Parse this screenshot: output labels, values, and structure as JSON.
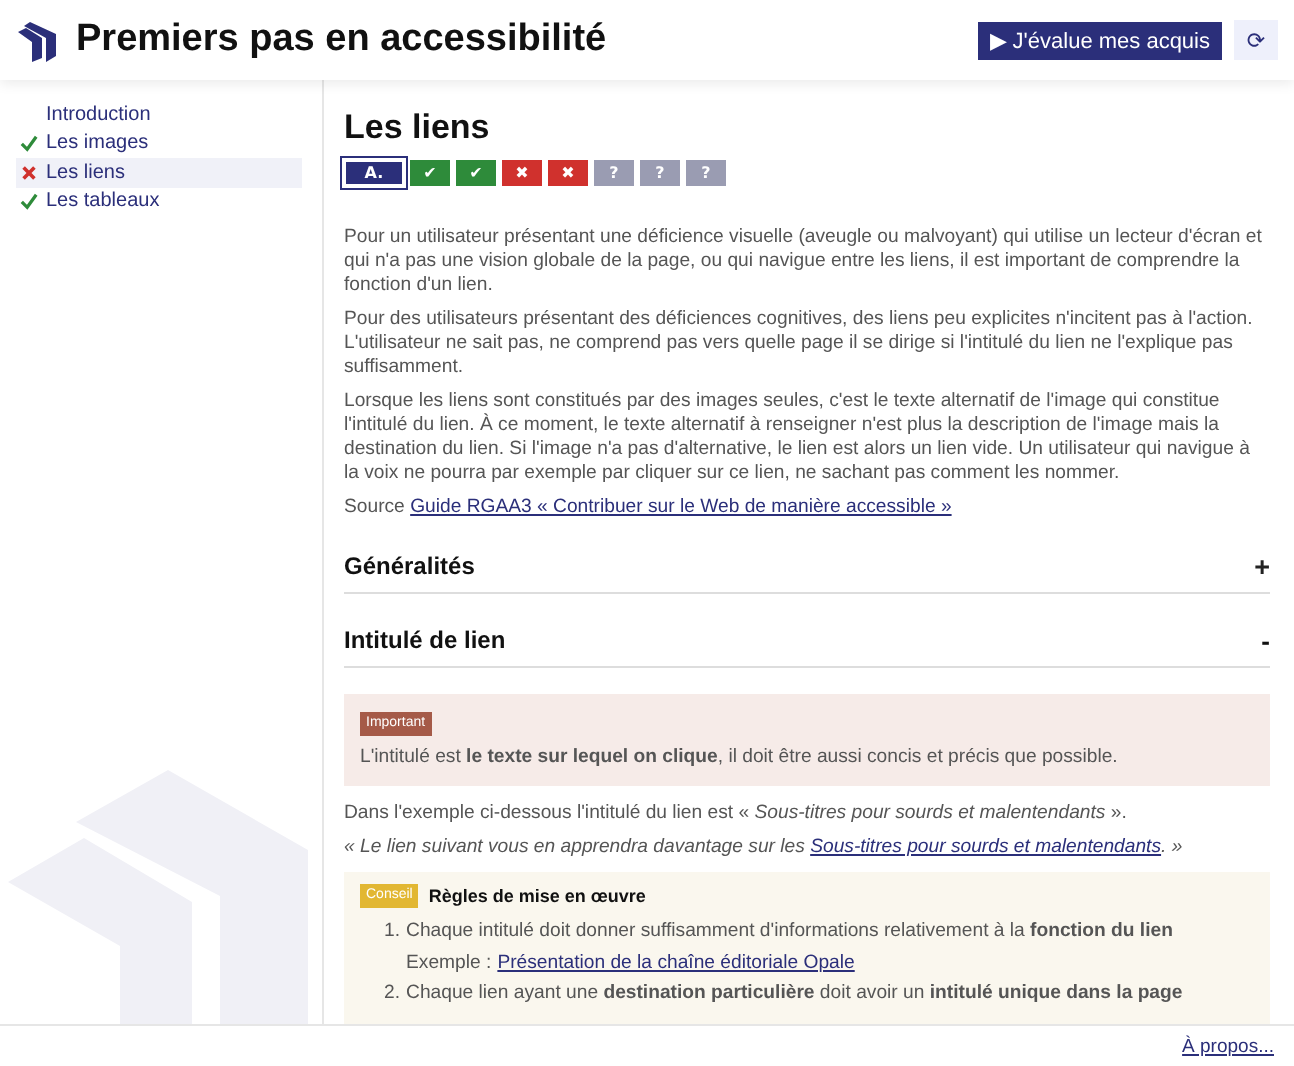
{
  "header": {
    "title": "Premiers pas en accessibilité",
    "evaluate_button": "▶ J'évalue mes acquis",
    "reset_button": "⟳"
  },
  "sidebar": {
    "items": [
      {
        "label": "Introduction",
        "kind": "plain",
        "selected": false
      },
      {
        "label": "Les images",
        "kind": "done",
        "selected": false
      },
      {
        "label": "Les liens",
        "kind": "failed",
        "selected": true
      },
      {
        "label": "Les tableaux",
        "kind": "done",
        "selected": false
      }
    ]
  },
  "content": {
    "title": "Les liens",
    "steps": [
      {
        "label": "A.",
        "kind": "current",
        "selected": true
      },
      {
        "label": "✔",
        "kind": "pass",
        "selected": false
      },
      {
        "label": "✔",
        "kind": "pass",
        "selected": false
      },
      {
        "label": "✖",
        "kind": "fail",
        "selected": false
      },
      {
        "label": "✖",
        "kind": "fail",
        "selected": false
      },
      {
        "label": "?",
        "kind": "unknown",
        "selected": false
      },
      {
        "label": "?",
        "kind": "unknown",
        "selected": false
      },
      {
        "label": "?",
        "kind": "unknown",
        "selected": false
      }
    ],
    "paragraphs": [
      "Pour un utilisateur présentant une déficience visuelle (aveugle ou malvoyant) qui utilise un lecteur d'écran et qui n'a pas une vision globale de la page, ou qui navigue entre les liens, il est important de comprendre la fonction d'un lien.",
      "Pour des utilisateurs présentant des déficiences cognitives, des liens peu explicites n'incitent pas à l'action. L'utilisateur ne sait pas, ne comprend pas vers quelle page il se dirige si l'intitulé du lien ne l'explique pas suffisamment.",
      "Lorsque les liens sont constitués par des images seules, c'est le texte alternatif de l'image qui constitue l'intitulé du lien. À ce moment, le texte alternatif à renseigner n'est plus la description de l'image mais la destination du lien. Si l'image n'a pas d'alternative, le lien est alors un lien vide. Un utilisateur qui navigue à la voix ne pourra par exemple par cliquer sur ce lien, ne sachant pas comment les nommer."
    ],
    "source": {
      "label": "Source",
      "link": "Guide RGAA3 « Contribuer sur le Web de manière accessible »"
    },
    "sections": [
      {
        "title": "Généralités",
        "toggle": "+",
        "expanded": false
      },
      {
        "title": "Intitulé de lien",
        "toggle": "-",
        "expanded": true,
        "important": {
          "badge": "Important",
          "text": "L'intitulé est **le texte sur lequel on clique**, il doit être aussi concis et précis que possible."
        },
        "example": "Dans l'exemple ci-dessous l'intitulé du lien est « *Sous-titres pour sourds et malentendants* ».",
        "quote": {
          "before": "« Le lien suivant vous en apprendra davantage sur les",
          "link": "Sous-titres pour sourds et malentendants",
          "after": ". »"
        },
        "advice": {
          "badge": "Conseil",
          "title": "Règles de mise en œuvre",
          "rules": [
            {
              "number": "1.",
              "text": "Chaque intitulé doit donner suffisamment d'informations relativement à la **fonction du lien**",
              "example_label": "Exemple :",
              "example_link": "Présentation de la chaîne éditoriale Opale"
            },
            {
              "number": "2.",
              "text": "Chaque lien ayant une **destination particulière** doit avoir un **intitulé unique dans la page**"
            }
          ]
        }
      }
    ]
  },
  "footer": {
    "about_link": "À propos..."
  }
}
